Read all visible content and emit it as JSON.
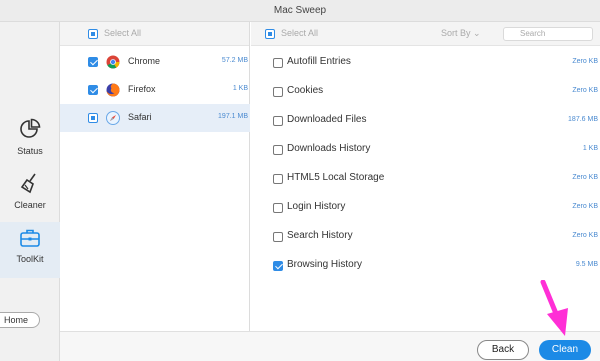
{
  "window": {
    "title": "Mac Sweep"
  },
  "sidebar": {
    "items": [
      {
        "label": "Status",
        "icon": "pie-chart-icon"
      },
      {
        "label": "Cleaner",
        "icon": "broom-icon"
      },
      {
        "label": "ToolKit",
        "icon": "toolbox-icon",
        "active": true
      }
    ],
    "home_label": "Home"
  },
  "browsers": {
    "select_all_label": "Select All",
    "items": [
      {
        "name": "Chrome",
        "size": "57.2 MB",
        "checked": true
      },
      {
        "name": "Firefox",
        "size": "1 KB",
        "checked": true
      },
      {
        "name": "Safari",
        "size": "197.1 MB",
        "checked": "partial",
        "selected": true
      }
    ]
  },
  "entries": {
    "select_all_label": "Select All",
    "sort_label": "Sort By",
    "search_placeholder": "Search",
    "items": [
      {
        "name": "Autofill Entries",
        "size": "Zero KB",
        "checked": false
      },
      {
        "name": "Cookies",
        "size": "Zero KB",
        "checked": false
      },
      {
        "name": "Downloaded Files",
        "size": "187.6 MB",
        "checked": false
      },
      {
        "name": "Downloads History",
        "size": "1 KB",
        "checked": false
      },
      {
        "name": "HTML5 Local Storage",
        "size": "Zero KB",
        "checked": false
      },
      {
        "name": "Login History",
        "size": "Zero KB",
        "checked": false
      },
      {
        "name": "Search History",
        "size": "Zero KB",
        "checked": false
      },
      {
        "name": "Browsing History",
        "size": "9.5 MB",
        "checked": true
      }
    ]
  },
  "footer": {
    "back_label": "Back",
    "clean_label": "Clean"
  },
  "colors": {
    "accent": "#1c8ae6",
    "annotation_arrow": "#ff2fd6"
  }
}
